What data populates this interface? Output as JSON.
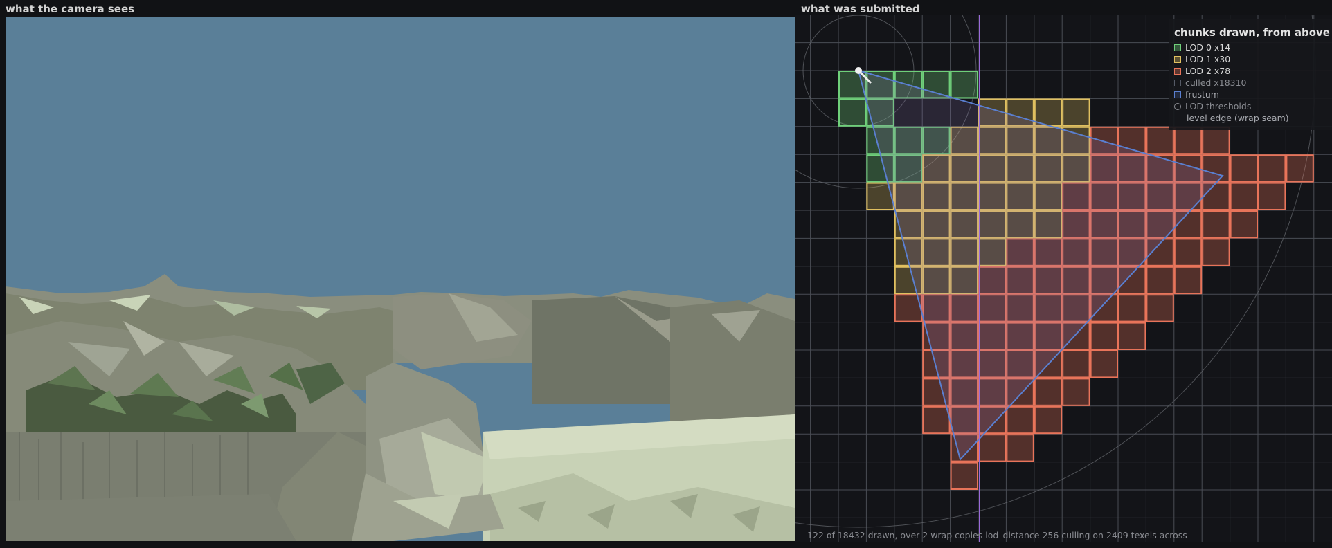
{
  "left_panel": {
    "title": "what the camera sees"
  },
  "right_panel": {
    "title": "what was submitted"
  },
  "legend": {
    "title": "chunks drawn, from above",
    "items": [
      {
        "label": "LOD 0  x14",
        "color": "#6fd07a",
        "style": "square"
      },
      {
        "label": "LOD 1  x30",
        "color": "#e0c060",
        "style": "square"
      },
      {
        "label": "LOD 2  x78",
        "color": "#e8745a",
        "style": "square"
      },
      {
        "label": "culled  x18310",
        "color": "#555a66",
        "style": "square"
      },
      {
        "label": "frustum",
        "color": "#5a7fd0",
        "style": "square"
      },
      {
        "label": "LOD thresholds",
        "color": "#8a8c92",
        "style": "circle"
      },
      {
        "label": "level edge (wrap seam)",
        "color": "#9a6ad8",
        "style": "line"
      }
    ]
  },
  "status": {
    "text": "122 of 18432 drawn, over 2 wrap copies   lod_distance 256   culling on   2409 texels across"
  },
  "colors": {
    "lod0": "#6fd07a",
    "lod1": "#e0c060",
    "lod2": "#e8745a",
    "frustum": "#5a7fd0",
    "seam": "#9a6ad8",
    "grid": "#4a4d55",
    "sky": "#5a7f98"
  },
  "chunk_map": {
    "rows": [
      {
        "row": 0,
        "lod0": [
          0,
          4
        ],
        "lod1": [],
        "lod2": []
      },
      {
        "row": 1,
        "lod0": [
          0,
          1
        ],
        "lod1": [
          5,
          8
        ],
        "lod2": []
      },
      {
        "row": 2,
        "lod0": [
          1,
          3
        ],
        "lod1": [
          4,
          8
        ],
        "lod2": [
          9,
          13
        ]
      },
      {
        "row": 3,
        "lod0": [
          1,
          2
        ],
        "lod1": [
          3,
          8
        ],
        "lod2": [
          9,
          16
        ]
      },
      {
        "row": 4,
        "lod0": [],
        "lod1": [
          1,
          7
        ],
        "lod2": [
          8,
          15
        ]
      },
      {
        "row": 5,
        "lod0": [],
        "lod1": [
          2,
          7
        ],
        "lod2": [
          8,
          14
        ]
      },
      {
        "row": 6,
        "lod0": [],
        "lod1": [
          2,
          5
        ],
        "lod2": [
          6,
          13
        ]
      },
      {
        "row": 7,
        "lod0": [],
        "lod1": [
          2,
          4
        ],
        "lod2": [
          5,
          12
        ]
      },
      {
        "row": 8,
        "lod0": [],
        "lod1": [],
        "lod2": [
          2,
          11
        ]
      },
      {
        "row": 9,
        "lod0": [],
        "lod1": [],
        "lod2": [
          3,
          10
        ]
      },
      {
        "row": 10,
        "lod0": [],
        "lod1": [],
        "lod2": [
          3,
          9
        ]
      },
      {
        "row": 11,
        "lod0": [],
        "lod1": [],
        "lod2": [
          3,
          8
        ]
      },
      {
        "row": 12,
        "lod0": [],
        "lod1": [],
        "lod2": [
          3,
          7
        ]
      },
      {
        "row": 13,
        "lod0": [],
        "lod1": [],
        "lod2": [
          4,
          6
        ]
      },
      {
        "row": 14,
        "lod0": [],
        "lod1": [],
        "lod2": [
          4,
          4
        ]
      }
    ]
  }
}
